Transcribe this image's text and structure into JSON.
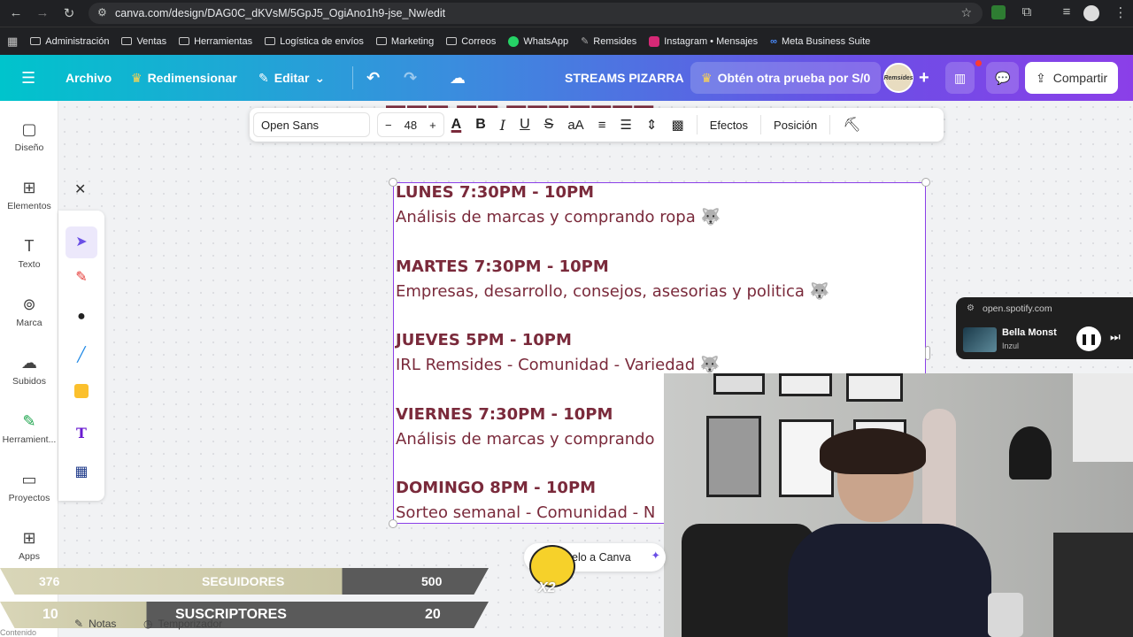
{
  "browser": {
    "url": "canva.com/design/DAG0C_dKVsM/5GpJ5_OgiAno1h9-jse_Nw/edit",
    "bookmarks": [
      "Administración",
      "Ventas",
      "Herramientas",
      "Logística de envíos",
      "Marketing",
      "Correos",
      "WhatsApp",
      "Remsides",
      "Instagram • Mensajes",
      "Meta Business Suite"
    ]
  },
  "canva": {
    "archivo": "Archivo",
    "redimensionar": "Redimensionar",
    "editar": "Editar",
    "title": "STREAMS PIZARRA",
    "trial": "Obtén otra prueba por S/0",
    "share": "Compartir",
    "avatar_text": "Remsides"
  },
  "sidebar": {
    "items": [
      "Diseño",
      "Elementos",
      "Texto",
      "Marca",
      "Subidos",
      "Herramient...",
      "Proyectos",
      "Apps"
    ]
  },
  "text_toolbar": {
    "font": "Open Sans",
    "size": "48",
    "effects": "Efectos",
    "position": "Posición"
  },
  "schedule": [
    {
      "day": "LUNES 7:30PM - 10PM",
      "desc": "Análisis de marcas y comprando ropa 🐺"
    },
    {
      "day": "MARTES 7:30PM - 10PM",
      "desc": "Empresas, desarrollo, consejos, asesorias y politica 🐺"
    },
    {
      "day": "JUEVES 5PM - 10PM",
      "desc": "IRL Remsides - Comunidad - Variedad 🐺"
    },
    {
      "day": "VIERNES 7:30PM - 10PM",
      "desc": "Análisis de marcas y comprando"
    },
    {
      "day": "DOMINGO 8PM - 10PM",
      "desc": "Sorteo semanal - Comunidad - N"
    }
  ],
  "spotify": {
    "site": "open.spotify.com",
    "track": "Bella Monst",
    "artist": "Inzul"
  },
  "overlay": {
    "seguidores_current": "376",
    "seguidores_label": "SEGUIDORES",
    "seguidores_goal": "500",
    "suscriptores_current": "10",
    "suscriptores_label": "SUSCRIPTORES",
    "suscriptores_goal": "20",
    "canva_chip": "elo a Canva",
    "bee_badge": "X2",
    "notes": "Notas",
    "timer": "Temporizador",
    "footer_left": "Contenido"
  },
  "colors": {
    "text_maroon": "#7a2a3b",
    "selection": "#8b3fe8"
  }
}
